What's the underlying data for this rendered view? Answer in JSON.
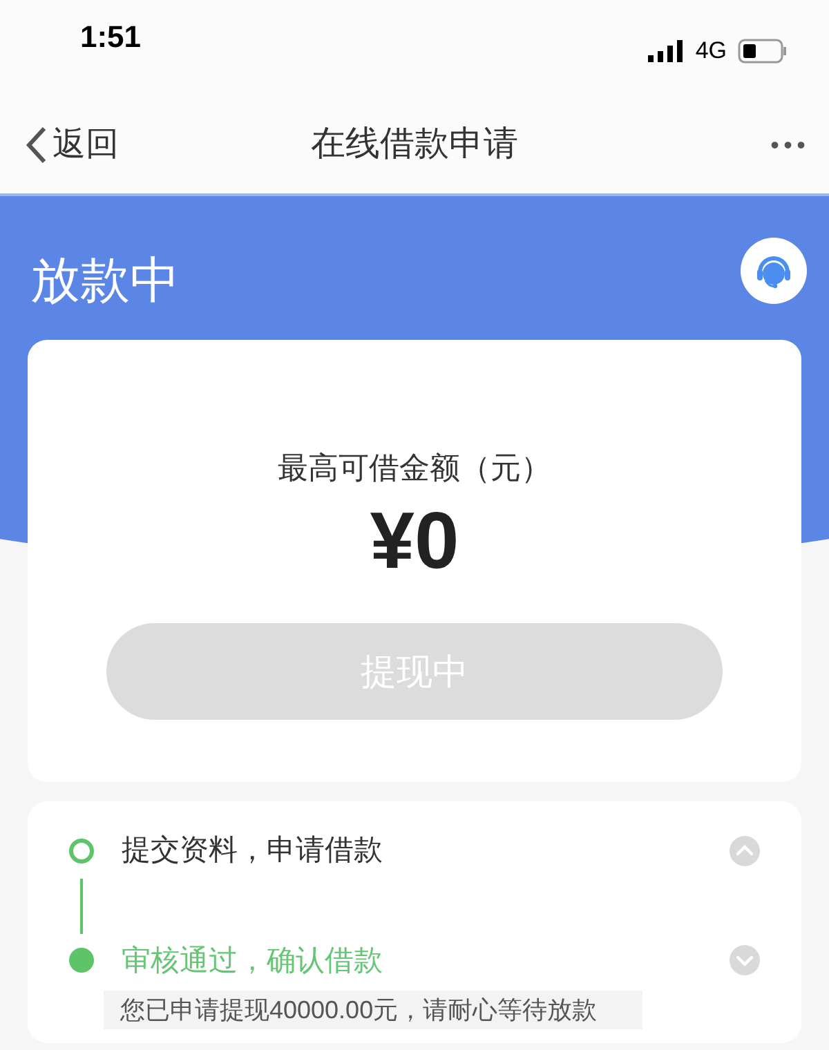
{
  "status_bar": {
    "time": "1:51",
    "network": "4G"
  },
  "nav": {
    "back": "返回",
    "title": "在线借款申请",
    "more": "• • •"
  },
  "header": {
    "title": "放款中"
  },
  "amount_card": {
    "label": "最高可借金额（元）",
    "amount": "¥0",
    "button": {
      "label": "提现中",
      "disabled": true
    }
  },
  "steps": [
    {
      "title": "提交资料，申请借款",
      "active": false,
      "expanded": true
    },
    {
      "title": "审核通过，确认借款",
      "active": true,
      "expanded": false,
      "note": "您已申请提现40000.00元，请耐心等待放款"
    }
  ]
}
